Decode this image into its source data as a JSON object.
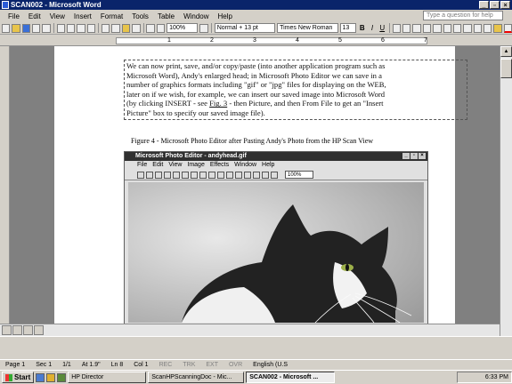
{
  "window": {
    "title": "SCAN002 - Microsoft Word"
  },
  "menu": [
    "File",
    "Edit",
    "View",
    "Insert",
    "Format",
    "Tools",
    "Table",
    "Window",
    "Help"
  ],
  "help_box": {
    "placeholder": "Type a question for help"
  },
  "toolbar": {
    "zoom": "100%",
    "style": "Normal + 13 pt",
    "font": "Times New Roman",
    "size": "13",
    "bold": "B",
    "italic": "I",
    "underline": "U"
  },
  "ruler": {
    "numbers": [
      "1",
      "2",
      "3",
      "4",
      "5",
      "6",
      "7"
    ]
  },
  "document": {
    "paragraph_lines": [
      "We can now print, save, and/or copy/paste (into another application program such as",
      "Microsoft Word), Andy's enlarged head; in Microsoft Photo Editor we can save in a",
      "number of graphics formats including \"gif\" or \"jpg\" files for displaying on the WEB,",
      "later on if we wish, for example, we can insert our saved image into Microsoft Word",
      "(by clicking INSERT - see ",
      "Fig. 3",
      " - then Picture, and then From File to get an \"Insert",
      "Picture\" box to specify our saved image file)."
    ],
    "caption": "Figure 4 - Microsoft Photo Editor after Pasting Andy's Photo from the HP Scan View"
  },
  "photo_editor": {
    "title": "Microsoft Photo Editor - andyhead.gif",
    "menu": [
      "File",
      "Edit",
      "View",
      "Image",
      "Effects",
      "Window",
      "Help"
    ],
    "zoom": "100%"
  },
  "statusbar": {
    "page": "Page 1",
    "sec": "Sec 1",
    "pages": "1/1",
    "at": "At 1.9\"",
    "ln": "Ln 8",
    "col": "Col 1",
    "rec": "REC",
    "trk": "TRK",
    "ext": "EXT",
    "ovr": "OVR",
    "lang": "English (U.S"
  },
  "taskbar": {
    "start": "Start",
    "tasks": [
      "HP Director",
      "ScanHPScanningDoc - Mic...",
      "SCAN002 - Microsoft ..."
    ],
    "clock": "6:33 PM"
  }
}
